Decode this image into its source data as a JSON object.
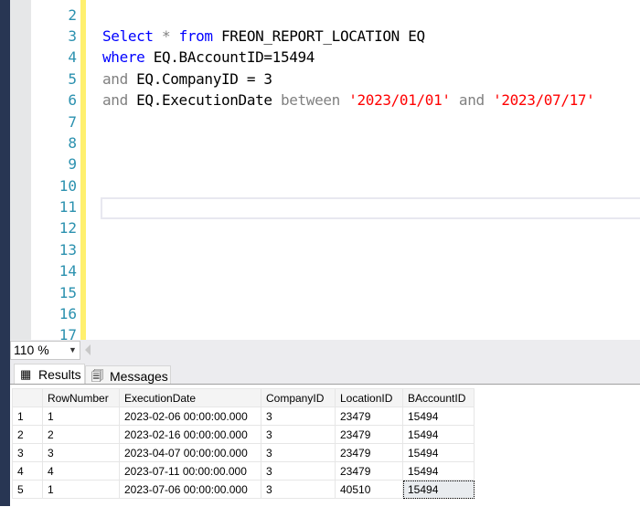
{
  "editor": {
    "line_numbers": [
      "2",
      "3",
      "4",
      "5",
      "6",
      "7",
      "8",
      "9",
      "10",
      "11",
      "12",
      "13",
      "14",
      "15",
      "16",
      "17"
    ],
    "code": {
      "line3": {
        "kw1": "Select",
        "mid1": " * ",
        "kw2": "from",
        "rest": " FREON_REPORT_LOCATION EQ"
      },
      "line4": {
        "kw": "where",
        "rest": " EQ.BAccountID=15494"
      },
      "line5": {
        "kw": "and",
        "rest": " EQ.CompanyID = 3"
      },
      "line6": {
        "kw": "and",
        "rest": " EQ.ExecutionDate ",
        "op": "between",
        "s1": "'2023/01/01'",
        "and": " and ",
        "s2": "'2023/07/17'"
      }
    }
  },
  "statusbar": {
    "zoom_level": "110 %"
  },
  "tabs": [
    {
      "label": "Results",
      "icon": "grid-icon",
      "active": true
    },
    {
      "label": "Messages",
      "icon": "messages-icon",
      "active": false
    }
  ],
  "results": {
    "columns": [
      "",
      "RowNumber",
      "ExecutionDate",
      "CompanyID",
      "LocationID",
      "BAccountID"
    ],
    "rows": [
      [
        "1",
        "1",
        "2023-02-06 00:00:00.000",
        "3",
        "23479",
        "15494"
      ],
      [
        "2",
        "2",
        "2023-02-16 00:00:00.000",
        "3",
        "23479",
        "15494"
      ],
      [
        "3",
        "3",
        "2023-04-07 00:00:00.000",
        "3",
        "23479",
        "15494"
      ],
      [
        "4",
        "4",
        "2023-07-11 00:00:00.000",
        "3",
        "23479",
        "15494"
      ],
      [
        "5",
        "1",
        "2023-07-06 00:00:00.000",
        "3",
        "40510",
        "15494"
      ]
    ]
  }
}
